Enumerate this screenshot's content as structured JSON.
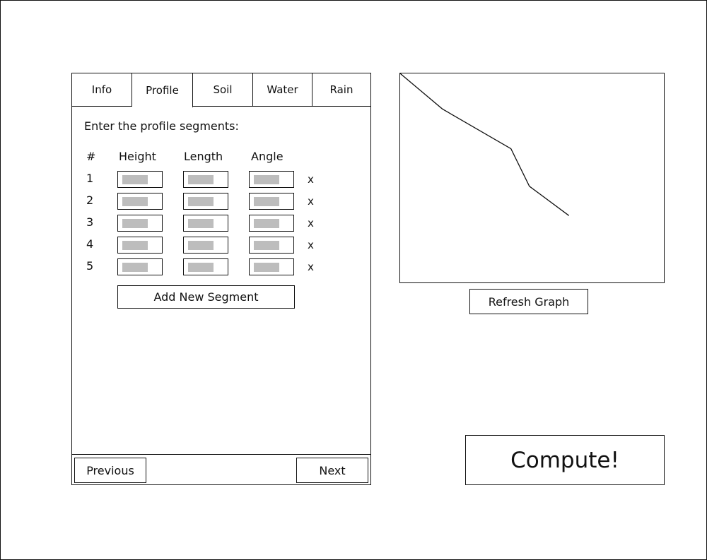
{
  "tabs": [
    {
      "label": "Info",
      "active": false
    },
    {
      "label": "Profile",
      "active": true
    },
    {
      "label": "Soil",
      "active": false
    },
    {
      "label": "Water",
      "active": false
    },
    {
      "label": "Rain",
      "active": false
    }
  ],
  "profile": {
    "instructions": "Enter the profile segments:",
    "columns": {
      "number": "#",
      "height": "Height",
      "length": "Length",
      "angle": "Angle"
    },
    "rows": [
      {
        "number": "1",
        "height": "",
        "length": "",
        "angle": "",
        "delete": "x"
      },
      {
        "number": "2",
        "height": "",
        "length": "",
        "angle": "",
        "delete": "x"
      },
      {
        "number": "3",
        "height": "",
        "length": "",
        "angle": "",
        "delete": "x"
      },
      {
        "number": "4",
        "height": "",
        "length": "",
        "angle": "",
        "delete": "x"
      },
      {
        "number": "5",
        "height": "",
        "length": "",
        "angle": "",
        "delete": "x"
      }
    ],
    "add_segment_label": "Add New Segment"
  },
  "nav": {
    "previous_label": "Previous",
    "next_label": "Next"
  },
  "graph": {
    "refresh_label": "Refresh Graph",
    "profile_points": [
      [
        0,
        0
      ],
      [
        0.16,
        0.17
      ],
      [
        0.42,
        0.36
      ],
      [
        0.49,
        0.54
      ],
      [
        0.64,
        0.68
      ]
    ]
  },
  "compute_label": "Compute!"
}
